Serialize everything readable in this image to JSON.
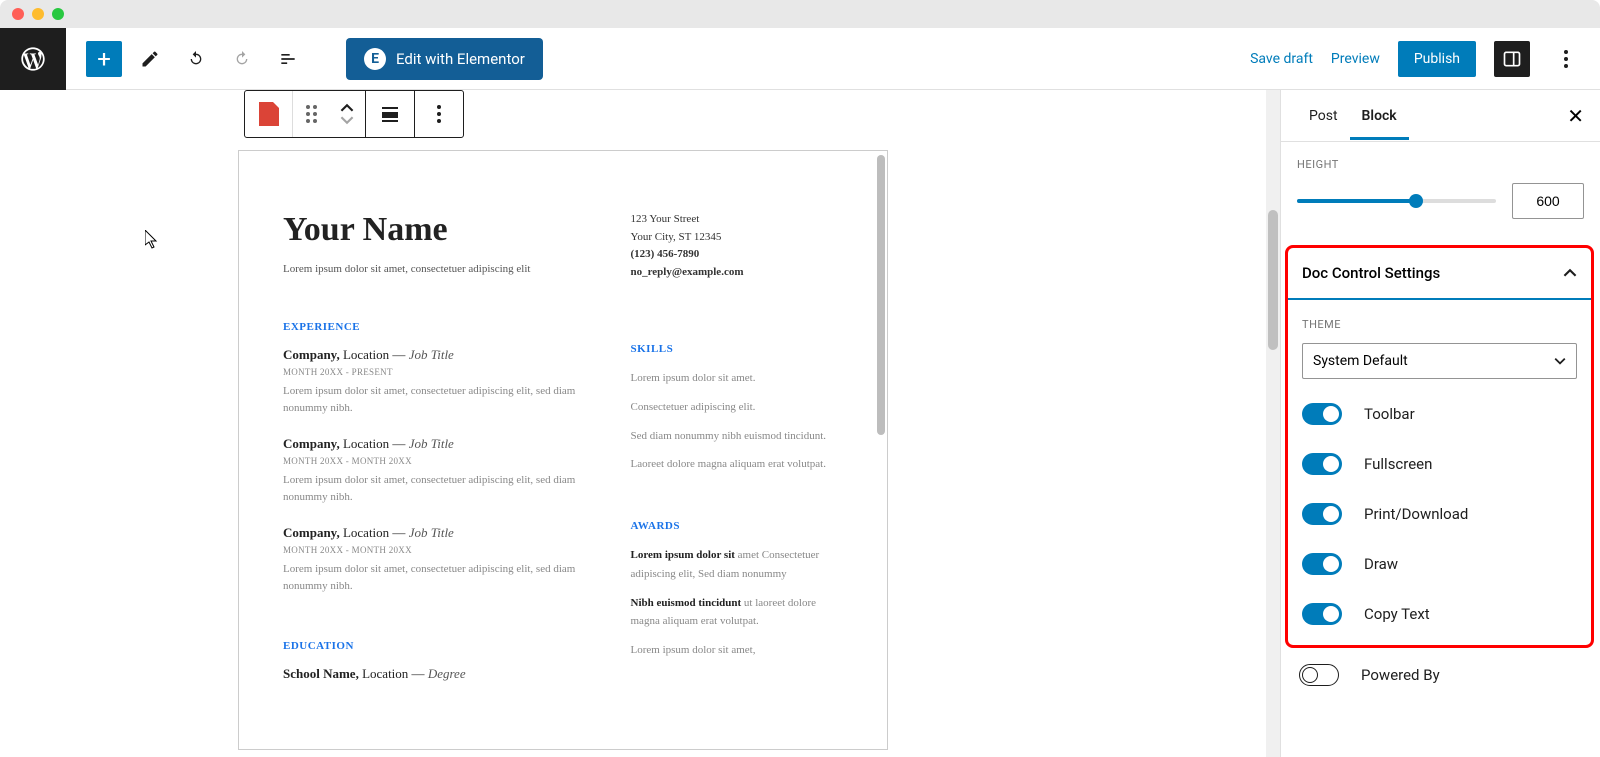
{
  "topbar": {
    "elementor_label": "Edit with Elementor",
    "save_draft": "Save draft",
    "preview": "Preview",
    "publish": "Publish"
  },
  "sidebar": {
    "tabs": {
      "post": "Post",
      "block": "Block"
    },
    "height_label": "HEIGHT",
    "height_value": "600",
    "doc_control_title": "Doc Control Settings",
    "theme_label": "THEME",
    "theme_value": "System Default",
    "toggles": {
      "toolbar": "Toolbar",
      "fullscreen": "Fullscreen",
      "print": "Print/Download",
      "draw": "Draw",
      "copy": "Copy Text",
      "powered": "Powered By"
    }
  },
  "doc": {
    "name": "Your Name",
    "tagline": "Lorem ipsum dolor sit amet, consectetuer adipiscing elit",
    "contact": {
      "street": "123 Your Street",
      "city": "Your City, ST 12345",
      "phone": "(123) 456-7890",
      "email": "no_reply@example.com"
    },
    "sections": {
      "experience": "EXPERIENCE",
      "education": "EDUCATION",
      "skills": "SKILLS",
      "awards": "AWARDS"
    },
    "exp": [
      {
        "line": "Company, Location — Job Title",
        "date": "MONTH 20XX - PRESENT",
        "desc": "Lorem ipsum dolor sit amet, consectetuer adipiscing elit, sed diam nonummy nibh."
      },
      {
        "line": "Company, Location — Job Title",
        "date": "MONTH 20XX - MONTH 20XX",
        "desc": "Lorem ipsum dolor sit amet, consectetuer adipiscing elit, sed diam nonummy nibh."
      },
      {
        "line": "Company, Location — Job Title",
        "date": "MONTH 20XX - MONTH 20XX",
        "desc": "Lorem ipsum dolor sit amet, consectetuer adipiscing elit, sed diam nonummy nibh."
      }
    ],
    "edu_line": "School Name, Location — Degree",
    "skills_text": "Lorem ipsum dolor sit amet. Consectetuer adipiscing elit. Sed diam nonummy nibh euismod tincidunt. Laoreet dolore magna aliquam erat volutpat.",
    "awards": {
      "a1_lead": "Lorem ipsum dolor sit",
      "a1_rest": " amet Consectetuer adipiscing elit, Sed diam nonummy",
      "a2_lead": "Nibh euismod tincidunt",
      "a2_rest": " ut laoreet dolore magna aliquam erat volutpat.",
      "a3": "Lorem ipsum dolor sit amet,"
    }
  }
}
